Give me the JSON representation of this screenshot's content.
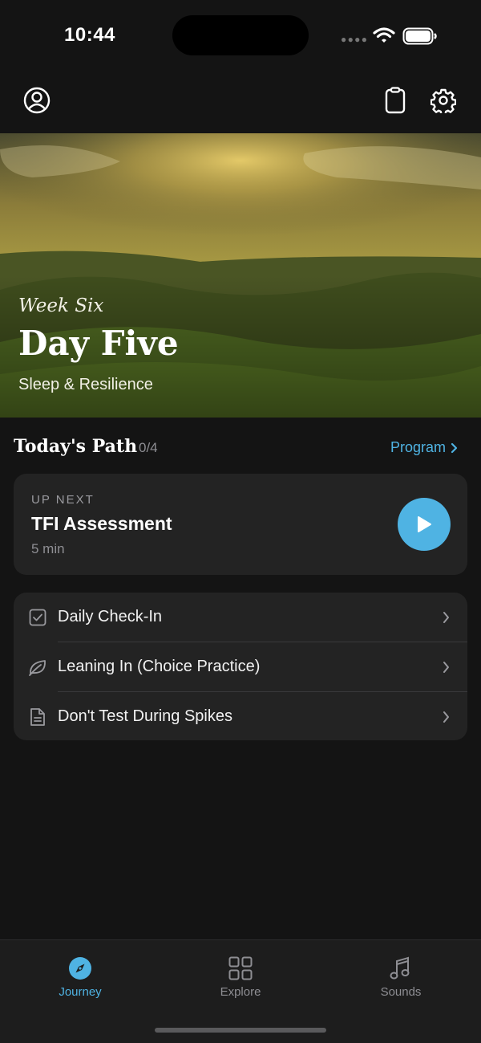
{
  "status_bar": {
    "time": "10:44"
  },
  "hero": {
    "week": "Week Six",
    "day": "Day Five",
    "subtitle": "Sleep & Resilience"
  },
  "path": {
    "title": "Today's Path",
    "progress": "0/4",
    "program_link": "Program"
  },
  "up_next": {
    "label": "UP NEXT",
    "title": "TFI Assessment",
    "duration": "5 min"
  },
  "tasks": [
    {
      "label": "Daily Check-In",
      "icon": "checkbox-icon"
    },
    {
      "label": "Leaning In (Choice Practice)",
      "icon": "leaf-icon"
    },
    {
      "label": "Don't Test During Spikes",
      "icon": "document-icon"
    }
  ],
  "tabs": [
    {
      "label": "Journey",
      "icon": "compass-icon",
      "active": true
    },
    {
      "label": "Explore",
      "icon": "grid-icon",
      "active": false
    },
    {
      "label": "Sounds",
      "icon": "music-note-icon",
      "active": false
    }
  ],
  "colors": {
    "accent": "#4fb3e3",
    "background": "#141414",
    "card": "#232323",
    "inactive": "#8e8e93"
  }
}
